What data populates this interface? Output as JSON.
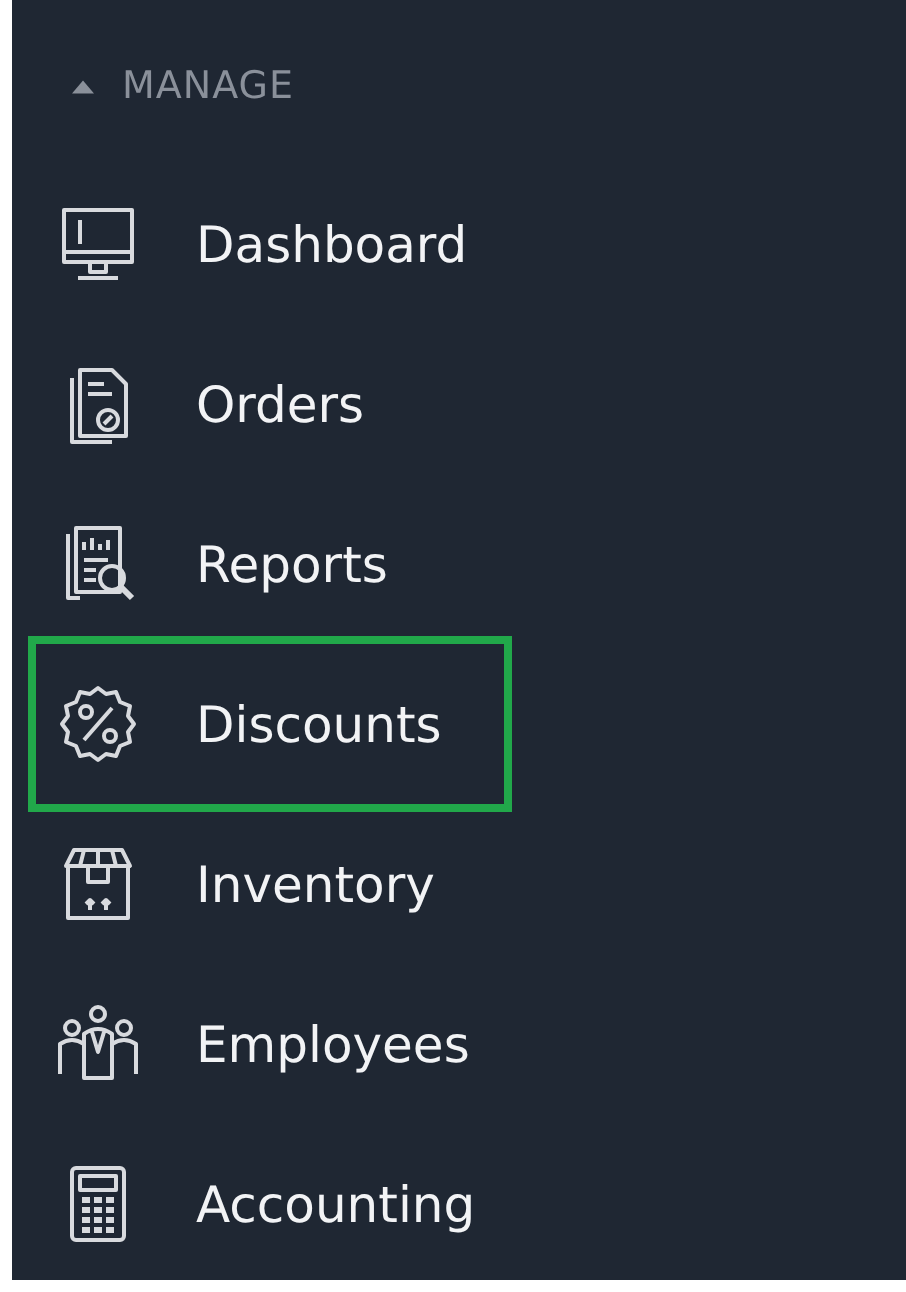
{
  "sidebar": {
    "section": {
      "title": "MANAGE",
      "expanded": true
    },
    "items": [
      {
        "label": "Dashboard",
        "highlighted": false
      },
      {
        "label": "Orders",
        "highlighted": false
      },
      {
        "label": "Reports",
        "highlighted": false
      },
      {
        "label": "Discounts",
        "highlighted": true
      },
      {
        "label": "Inventory",
        "highlighted": false
      },
      {
        "label": "Employees",
        "highlighted": false
      },
      {
        "label": "Accounting",
        "highlighted": false
      }
    ]
  }
}
